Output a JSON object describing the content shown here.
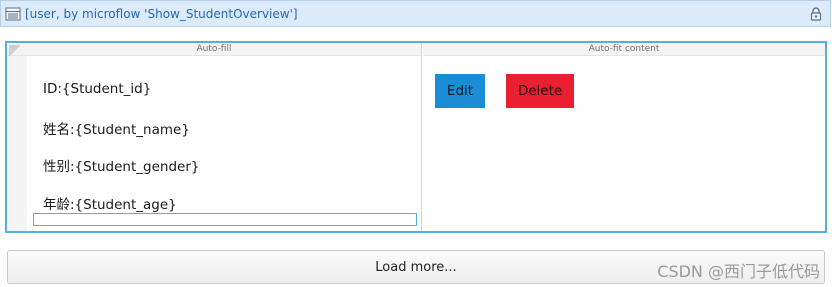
{
  "header": {
    "title": "[user, by microflow 'Show_StudentOverview']",
    "left_icon": "list-view-icon",
    "right_icon": "lock-settings-icon"
  },
  "columns": {
    "left_header": "Auto-fill",
    "right_header": "Auto-fit content"
  },
  "fields": [
    {
      "label": "ID:{Student_id}"
    },
    {
      "label": "姓名:{Student_name}"
    },
    {
      "label": "性别:{Student_gender}"
    },
    {
      "label": "年龄:{Student_age}"
    }
  ],
  "buttons": {
    "edit_label": "Edit",
    "delete_label": "Delete"
  },
  "load_more_label": "Load more...",
  "watermark": "CSDN @西门子低代码",
  "colors": {
    "header_bg": "#dcebfa",
    "selection_border": "#55aee0",
    "edit_bg": "#1b8dd6",
    "delete_bg": "#ea1f31"
  }
}
